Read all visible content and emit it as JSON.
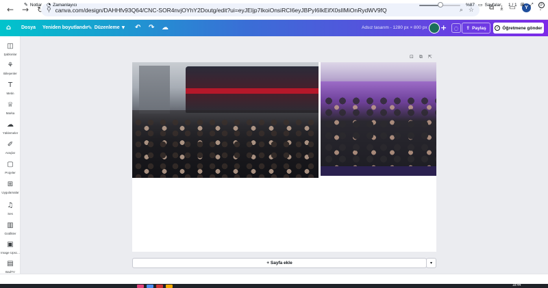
{
  "browser": {
    "back_icon": "back-arrow-icon",
    "forward_icon": "forward-arrow-icon",
    "reload_icon": "reload-icon",
    "url": "canva.com/design/DAHHfv93Q64/CNC-SOR4nvjOYhY2Doutg/edit?ui=eyJEIjp7IkoiOnsiRCI6eyJBPyI6IkEifX0sIlMiOnRydWV9fQ",
    "profile_initial": "Y"
  },
  "header": {
    "file_label": "Dosya",
    "resize_label": "Yeniden boyutlandır",
    "edit_label": "Düzenleme",
    "design_title": "Adsız tasarım - 1280 px × 800 px",
    "share_label": "Paylaş",
    "send_label": "Öğretmene gönder"
  },
  "sidebar": {
    "items": [
      {
        "label": "Şablonlar",
        "icon": "templates-icon"
      },
      {
        "label": "Bileşenler",
        "icon": "elements-icon"
      },
      {
        "label": "Metin",
        "icon": "text-icon"
      },
      {
        "label": "Marka",
        "icon": "brand-icon"
      },
      {
        "label": "Yüklemeler",
        "icon": "uploads-icon"
      },
      {
        "label": "Araçlar",
        "icon": "tools-icon"
      },
      {
        "label": "Projeler",
        "icon": "projects-icon"
      },
      {
        "label": "Uygulamalar",
        "icon": "apps-icon"
      },
      {
        "label": "Ses",
        "icon": "audio-icon"
      },
      {
        "label": "Grafikler",
        "icon": "charts-icon"
      },
      {
        "label": "Image Upsc...",
        "icon": "image-upscaler-icon"
      },
      {
        "label": "BadTV",
        "icon": "badtv-icon"
      }
    ]
  },
  "canvas": {
    "add_page_label": "+ Sayfa ekle"
  },
  "footer": {
    "notes_label": "Notlar",
    "timer_label": "Zamanlayıcı",
    "zoom_value": "%87",
    "zoom_level": 0.52,
    "pages_label": "Sayfalar",
    "page_count": "1 / 1"
  },
  "colors": {
    "header_start": "#00c4cc",
    "header_end": "#7d2ae8"
  },
  "taskbar": {
    "clock": "18:44"
  }
}
